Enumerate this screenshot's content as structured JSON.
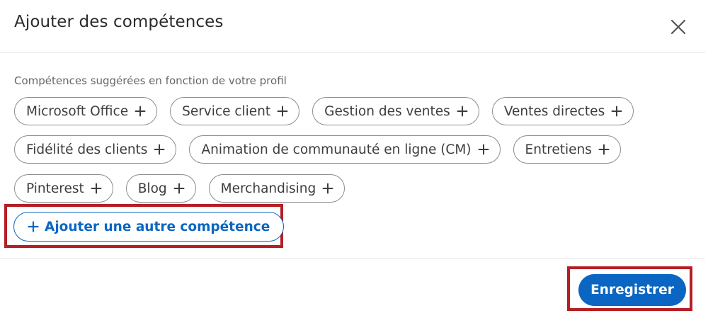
{
  "modal": {
    "title": "Ajouter des compétences",
    "close_icon": "close-icon"
  },
  "suggestions": {
    "label": "Compétences suggérées en fonction de votre profil",
    "rows": [
      [
        "Microsoft Office",
        "Service client",
        "Gestion des ventes",
        "Ventes directes"
      ],
      [
        "Fidélité des clients",
        "Animation de communauté en ligne (CM)",
        "Entretiens"
      ],
      [
        "Pinterest",
        "Blog",
        "Merchandising"
      ]
    ],
    "chip_icon": "plus-icon"
  },
  "add_other": {
    "label": "Ajouter une autre compétence",
    "icon": "plus-icon"
  },
  "footer": {
    "save_label": "Enregistrer"
  },
  "colors": {
    "accent": "#0a66c2",
    "highlight": "#b51e24",
    "chip_border": "#8c8c8c",
    "text": "#2b2b2b"
  }
}
